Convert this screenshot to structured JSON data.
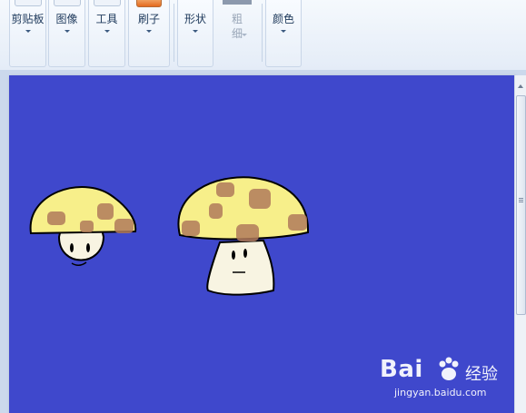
{
  "ribbon": {
    "groups": [
      {
        "label": "剪贴板"
      },
      {
        "label": "图像"
      },
      {
        "label": "工具"
      },
      {
        "label": "刷子"
      },
      {
        "label": "形状"
      },
      {
        "label": "粗细"
      },
      {
        "label": "颜色"
      }
    ]
  },
  "canvas": {
    "background_color": "#3f48cc",
    "drawing": {
      "subject": "two cartoon mushrooms",
      "cap_color": "#f7ef8a",
      "spot_color": "#b07a5a",
      "stem_color": "#f8f4e2"
    }
  },
  "watermark": {
    "brand": "Bai",
    "brand2": "经验",
    "url": "jingyan.baidu.com"
  }
}
